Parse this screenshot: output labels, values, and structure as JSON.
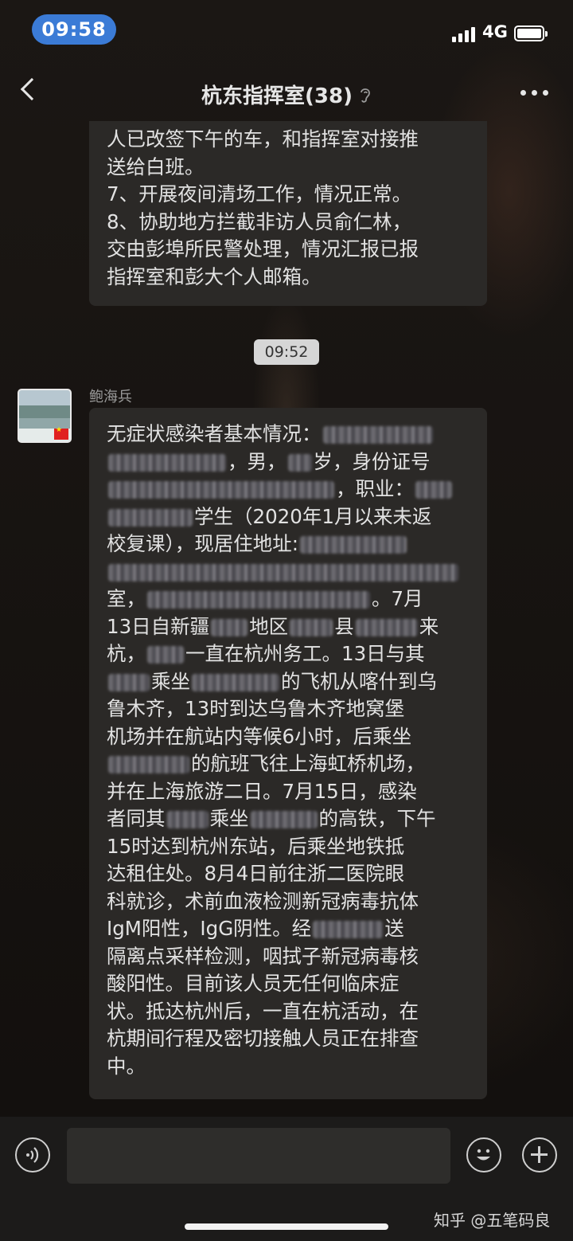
{
  "status_bar": {
    "time": "09:58",
    "network": "4G"
  },
  "nav": {
    "title": "杭东指挥室(38)"
  },
  "previous_message": {
    "lines": [
      "人已改签下午的车，和指挥室对接推",
      "送给白班。",
      "7、开展夜间清场工作，情况正常。",
      "8、协助地方拦截非访人员俞仁林，",
      "交由彭埠所民警处理，情况汇报已报",
      "指挥室和彭大个人邮箱。"
    ]
  },
  "timestamp": "09:52",
  "message": {
    "sender": "鲍海兵",
    "segments": {
      "s1": "无症状感染者基本情况：",
      "s2": "，男，",
      "s3": "岁，身份证号",
      "s4": "，职业：",
      "s5": "学生（2020年1月以来未返",
      "s6": "校复课），现居住地址:",
      "s7": "室，",
      "s8": "。7月",
      "s9": "13日自新疆",
      "s10": "地区",
      "s11": "县",
      "s12": "来",
      "s13": "杭，",
      "s14": "一直在杭州务工。13日与其",
      "s15": "乘坐",
      "s16": "的飞机从喀什到乌",
      "s17": "鲁木齐，13时到达乌鲁木齐地窝堡",
      "s18": "机场并在航站内等候6小时，后乘坐",
      "s19": "的航班飞往上海虹桥机场，",
      "s20": "并在上海旅游二日。7月15日，感染",
      "s21": "者同其",
      "s22": "乘坐",
      "s23": "的高铁，下午",
      "s24": "15时达到杭州东站，后乘坐地铁抵",
      "s25": "达租住处。8月4日前往浙二医院眼",
      "s26": "科就诊，术前血液检测新冠病毒抗体",
      "s27": "IgM阳性，IgG阴性。经",
      "s28": "送",
      "s29": "隔离点采样检测，咽拭子新冠病毒核",
      "s30": "酸阳性。目前该人员无任何临床症",
      "s31": "状。抵达杭州后，一直在杭活动，在",
      "s32": "杭期间行程及密切接触人员正在排查",
      "s33": "中。"
    }
  },
  "footer": {
    "watermark": "知乎 @五笔码良"
  },
  "icons": [
    "back-icon",
    "ear-icon",
    "more-icon",
    "voice-icon",
    "emoji-icon",
    "add-icon"
  ]
}
